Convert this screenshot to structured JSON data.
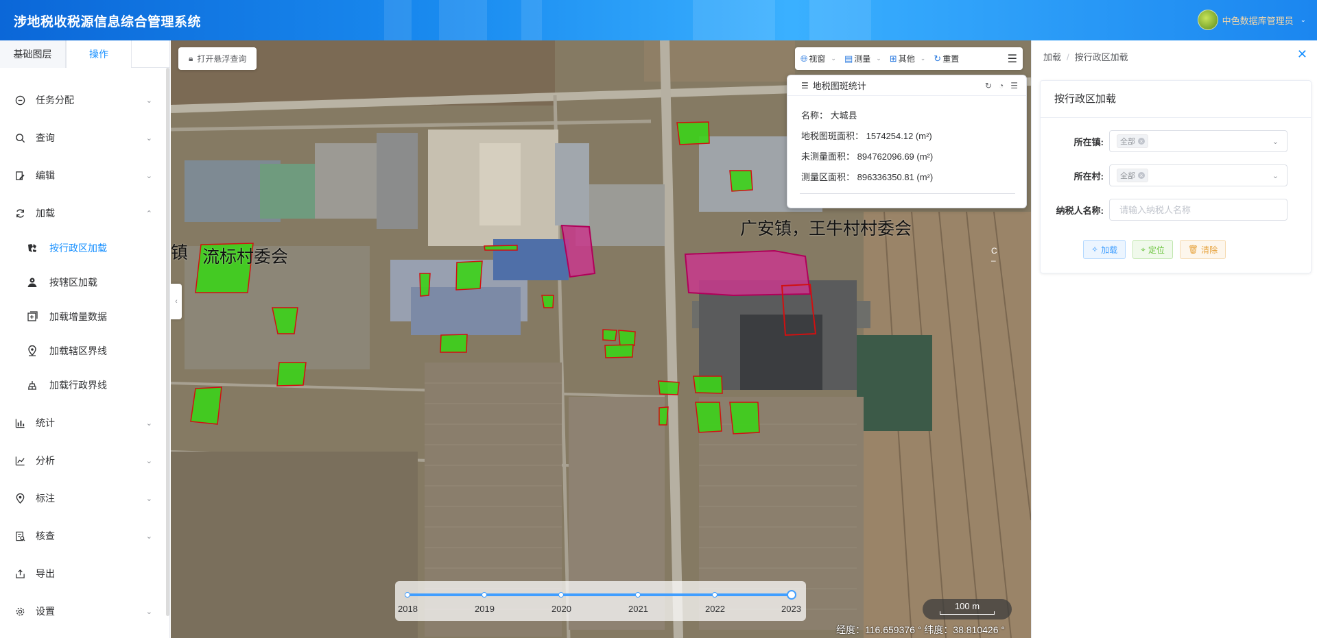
{
  "header": {
    "title": "涉地税收税源信息综合管理系统",
    "user": "中色数据库管理员"
  },
  "sidebar": {
    "tabs": [
      {
        "label": "基础图层",
        "active": false
      },
      {
        "label": "操作",
        "active": true
      }
    ],
    "items": [
      {
        "label": "任务分配",
        "icon": "task-icon",
        "expanded": false
      },
      {
        "label": "查询",
        "icon": "search-icon",
        "expanded": false
      },
      {
        "label": "编辑",
        "icon": "edit-icon",
        "expanded": false
      },
      {
        "label": "加载",
        "icon": "refresh-icon",
        "expanded": true
      },
      {
        "label": "统计",
        "icon": "bar-chart-icon",
        "expanded": false
      },
      {
        "label": "分析",
        "icon": "analysis-icon",
        "expanded": false
      },
      {
        "label": "标注",
        "icon": "location-pin-icon",
        "expanded": false
      },
      {
        "label": "核查",
        "icon": "check-doc-icon",
        "expanded": false
      },
      {
        "label": "导出",
        "icon": "export-icon",
        "expanded": false
      },
      {
        "label": "设置",
        "icon": "gear-icon",
        "expanded": false
      }
    ],
    "subitems": [
      {
        "label": "按行政区加载",
        "icon": "map-area-icon",
        "active": true
      },
      {
        "label": "按辖区加载",
        "icon": "user-area-icon",
        "active": false
      },
      {
        "label": "加载增量数据",
        "icon": "add-data-icon",
        "active": false
      },
      {
        "label": "加载辖区界线",
        "icon": "location-icon",
        "active": false
      },
      {
        "label": "加载行政界线",
        "icon": "boundary-icon",
        "active": false
      }
    ]
  },
  "map": {
    "float_button": "打开悬浮查询",
    "toolbar": [
      {
        "label": "视窗",
        "icon": "globe-icon"
      },
      {
        "label": "测量",
        "icon": "ruler-icon"
      },
      {
        "label": "其他",
        "icon": "grid-icon"
      },
      {
        "label": "重置",
        "icon": "reset-icon"
      }
    ],
    "stat_panel": {
      "title": "地税图斑统计",
      "rows": [
        {
          "label": "名称：",
          "value": "大城县"
        },
        {
          "label": "地税图斑面积：",
          "value": "1574254.12 (m²)"
        },
        {
          "label": "未测量面积：",
          "value": "894762096.69 (m²)"
        },
        {
          "label": "测量区面积：",
          "value": "896336350.81 (m²)"
        }
      ]
    },
    "labels": {
      "village_left": "流标村委会",
      "village_left_prefix": "镇",
      "village_right": "广安镇，王牛村村委会"
    },
    "timeline": {
      "years": [
        "2018",
        "2019",
        "2020",
        "2021",
        "2022",
        "2023"
      ],
      "selected": "2023"
    },
    "scale": "100 m",
    "coords": "经度：116.659376 °   纬度：38.810426 °"
  },
  "panel": {
    "breadcrumb": [
      "加载",
      "按行政区加载"
    ],
    "card_title": "按行政区加载",
    "town_label": "所在镇:",
    "town_value": "全部",
    "village_label": "所在村:",
    "village_value": "全部",
    "taxpayer_label": "纳税人名称:",
    "taxpayer_placeholder": "请输入纳税人名称",
    "taxpayer_value": "",
    "buttons": {
      "load": "加载",
      "locate": "定位",
      "clear": "清除"
    }
  }
}
